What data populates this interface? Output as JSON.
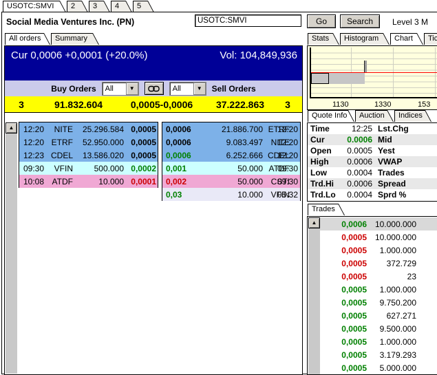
{
  "window": {
    "top_tabs": [
      "USOTC:SMVI",
      "2",
      "3",
      "4",
      "5"
    ],
    "title": "Social Media Ventures Inc. (PN)",
    "symbol_input": "USOTC:SMVI",
    "go_label": "Go",
    "search_label": "Search",
    "level_label": "Level 3 M"
  },
  "colors": {
    "header_navy": "#000097",
    "toolbar_lavender": "#cbcbeb",
    "summary_yellow": "#ffff00",
    "row_blue": "#7db1e8",
    "row_cyan": "#ccffff",
    "row_pink": "#f0a8d4",
    "row_lavender": "#e9e9f7",
    "up_green": "#008000",
    "down_red": "#cc0000",
    "chart_bg": "#ffffde",
    "chart_ref_line": "#ff0000"
  },
  "left": {
    "tabs": [
      "All orders",
      "Summary"
    ],
    "header": {
      "cur_line": "Cur 0,0006 +0,0001 (+20.0%)",
      "vol_line": "Vol: 104,849,936"
    },
    "toolbar": {
      "buy_label": "Buy Orders",
      "buy_filter": "All",
      "link_icon": "chain-link",
      "sell_filter": "All",
      "sell_label": "Sell Orders",
      "dropdown_icon": "▼"
    },
    "summary_row": {
      "buy_count": "3",
      "buy_size": "91.832.604",
      "spread": "0,0005-0,0006",
      "sell_size": "37.222.863",
      "sell_count": "3"
    },
    "buy_rows": [
      {
        "time": "12:20",
        "mm": "NITE",
        "size": "25.296.584",
        "price": "0,0005",
        "price_color": "black",
        "bg": "blue"
      },
      {
        "time": "12:20",
        "mm": "ETRF",
        "size": "52.950.000",
        "price": "0,0005",
        "price_color": "black",
        "bg": "blue"
      },
      {
        "time": "12:23",
        "mm": "CDEL",
        "size": "13.586.020",
        "price": "0,0005",
        "price_color": "black",
        "bg": "blue"
      },
      {
        "time": "09:30",
        "mm": "VFIN",
        "size": "500.000",
        "price": "0,0002",
        "price_color": "green",
        "bg": "cyan"
      },
      {
        "time": "10:08",
        "mm": "ATDF",
        "size": "10.000",
        "price": "0,0001",
        "price_color": "red",
        "bg": "pink"
      }
    ],
    "sell_rows": [
      {
        "price": "0,0006",
        "size": "21.886.700",
        "mm": "ETRF",
        "time": "12:20",
        "price_color": "black",
        "bg": "blue"
      },
      {
        "price": "0,0006",
        "size": "9.083.497",
        "mm": "NITE",
        "time": "12:20",
        "price_color": "black",
        "bg": "blue"
      },
      {
        "price": "0,0006",
        "size": "6.252.666",
        "mm": "CDEL",
        "time": "12:20",
        "price_color": "green",
        "bg": "blue"
      },
      {
        "price": "0,001",
        "size": "50.000",
        "mm": "ATDF",
        "time": "09:30",
        "price_color": "green",
        "bg": "cyan"
      },
      {
        "price": "0,002",
        "size": "50.000",
        "mm": "CSTI",
        "time": "09:30",
        "price_color": "red",
        "bg": "pink"
      },
      {
        "price": "0,03",
        "size": "10.000",
        "mm": "VFIN",
        "time": "05:32",
        "price_color": "green",
        "bg": "lavender"
      }
    ]
  },
  "right": {
    "chart_tabs": [
      "Stats",
      "Histogram",
      "Chart",
      "TickS"
    ],
    "chart": {
      "x_labels": [
        "1130",
        "1330",
        "153"
      ]
    },
    "info_tabs": [
      "Quote Info",
      "Auction",
      "Indices"
    ],
    "quote_rows": [
      {
        "l": "Time",
        "v": "12:25",
        "r": "Lst.Chg"
      },
      {
        "l": "Cur",
        "v": "0.0006",
        "r": "Mid",
        "value_color": "green"
      },
      {
        "l": "Open",
        "v": "0.0005",
        "r": "Yest"
      },
      {
        "l": "High",
        "v": "0.0006",
        "r": "VWAP"
      },
      {
        "l": "Low",
        "v": "0.0004",
        "r": "Trades"
      },
      {
        "l": "Trd.Hi",
        "v": "0.0006",
        "r": "Spread"
      },
      {
        "l": "Trd.Lo",
        "v": "0.0004",
        "r": "Sprd %"
      }
    ],
    "trades_tab": "Trades",
    "trades": [
      {
        "price": "0,0006",
        "size": "10.000.000",
        "color": "green",
        "selected": true
      },
      {
        "price": "0,0005",
        "size": "10.000.000",
        "color": "red"
      },
      {
        "price": "0,0005",
        "size": "1.000.000",
        "color": "red"
      },
      {
        "price": "0,0005",
        "size": "372.729",
        "color": "red"
      },
      {
        "price": "0,0005",
        "size": "23",
        "color": "red"
      },
      {
        "price": "0,0005",
        "size": "1.000.000",
        "color": "green"
      },
      {
        "price": "0,0005",
        "size": "9.750.200",
        "color": "green"
      },
      {
        "price": "0,0005",
        "size": "627.271",
        "color": "green"
      },
      {
        "price": "0,0005",
        "size": "9.500.000",
        "color": "green"
      },
      {
        "price": "0,0005",
        "size": "1.000.000",
        "color": "green"
      },
      {
        "price": "0,0005",
        "size": "3.179.293",
        "color": "green"
      },
      {
        "price": "0,0005",
        "size": "5.000.000",
        "color": "green"
      }
    ]
  }
}
